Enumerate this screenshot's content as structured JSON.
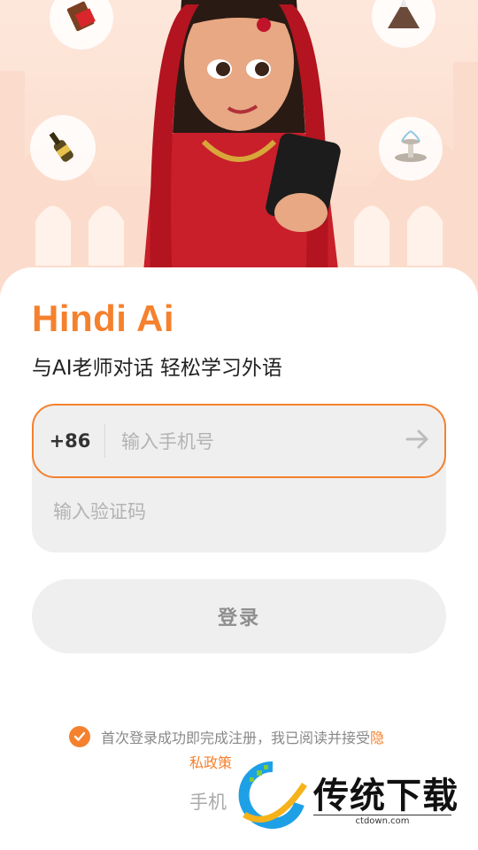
{
  "app": {
    "title": "Hindi Ai",
    "subtitle": "与AI老师对话 轻松学习外语"
  },
  "hero": {
    "illustration": "woman-in-red-saree-holding-phone",
    "icons": [
      "chocolate-icon",
      "volcano-icon",
      "bottle-icon",
      "fountain-icon"
    ]
  },
  "phone": {
    "country_code": "+86",
    "placeholder": "输入手机号"
  },
  "code": {
    "placeholder": "输入验证码"
  },
  "login": {
    "label": "登录"
  },
  "agreement": {
    "checked": true,
    "text": "首次登录成功即完成注册，我已阅读并接受",
    "link_start": "隐",
    "link_cont": "私政策"
  },
  "other_login": {
    "label": "手机"
  },
  "watermark": {
    "brand": "传统下载",
    "url": "ctdown.com"
  },
  "colors": {
    "accent": "#f5812e",
    "hero_bg": "#fde7db",
    "field_bg": "#efefef"
  }
}
